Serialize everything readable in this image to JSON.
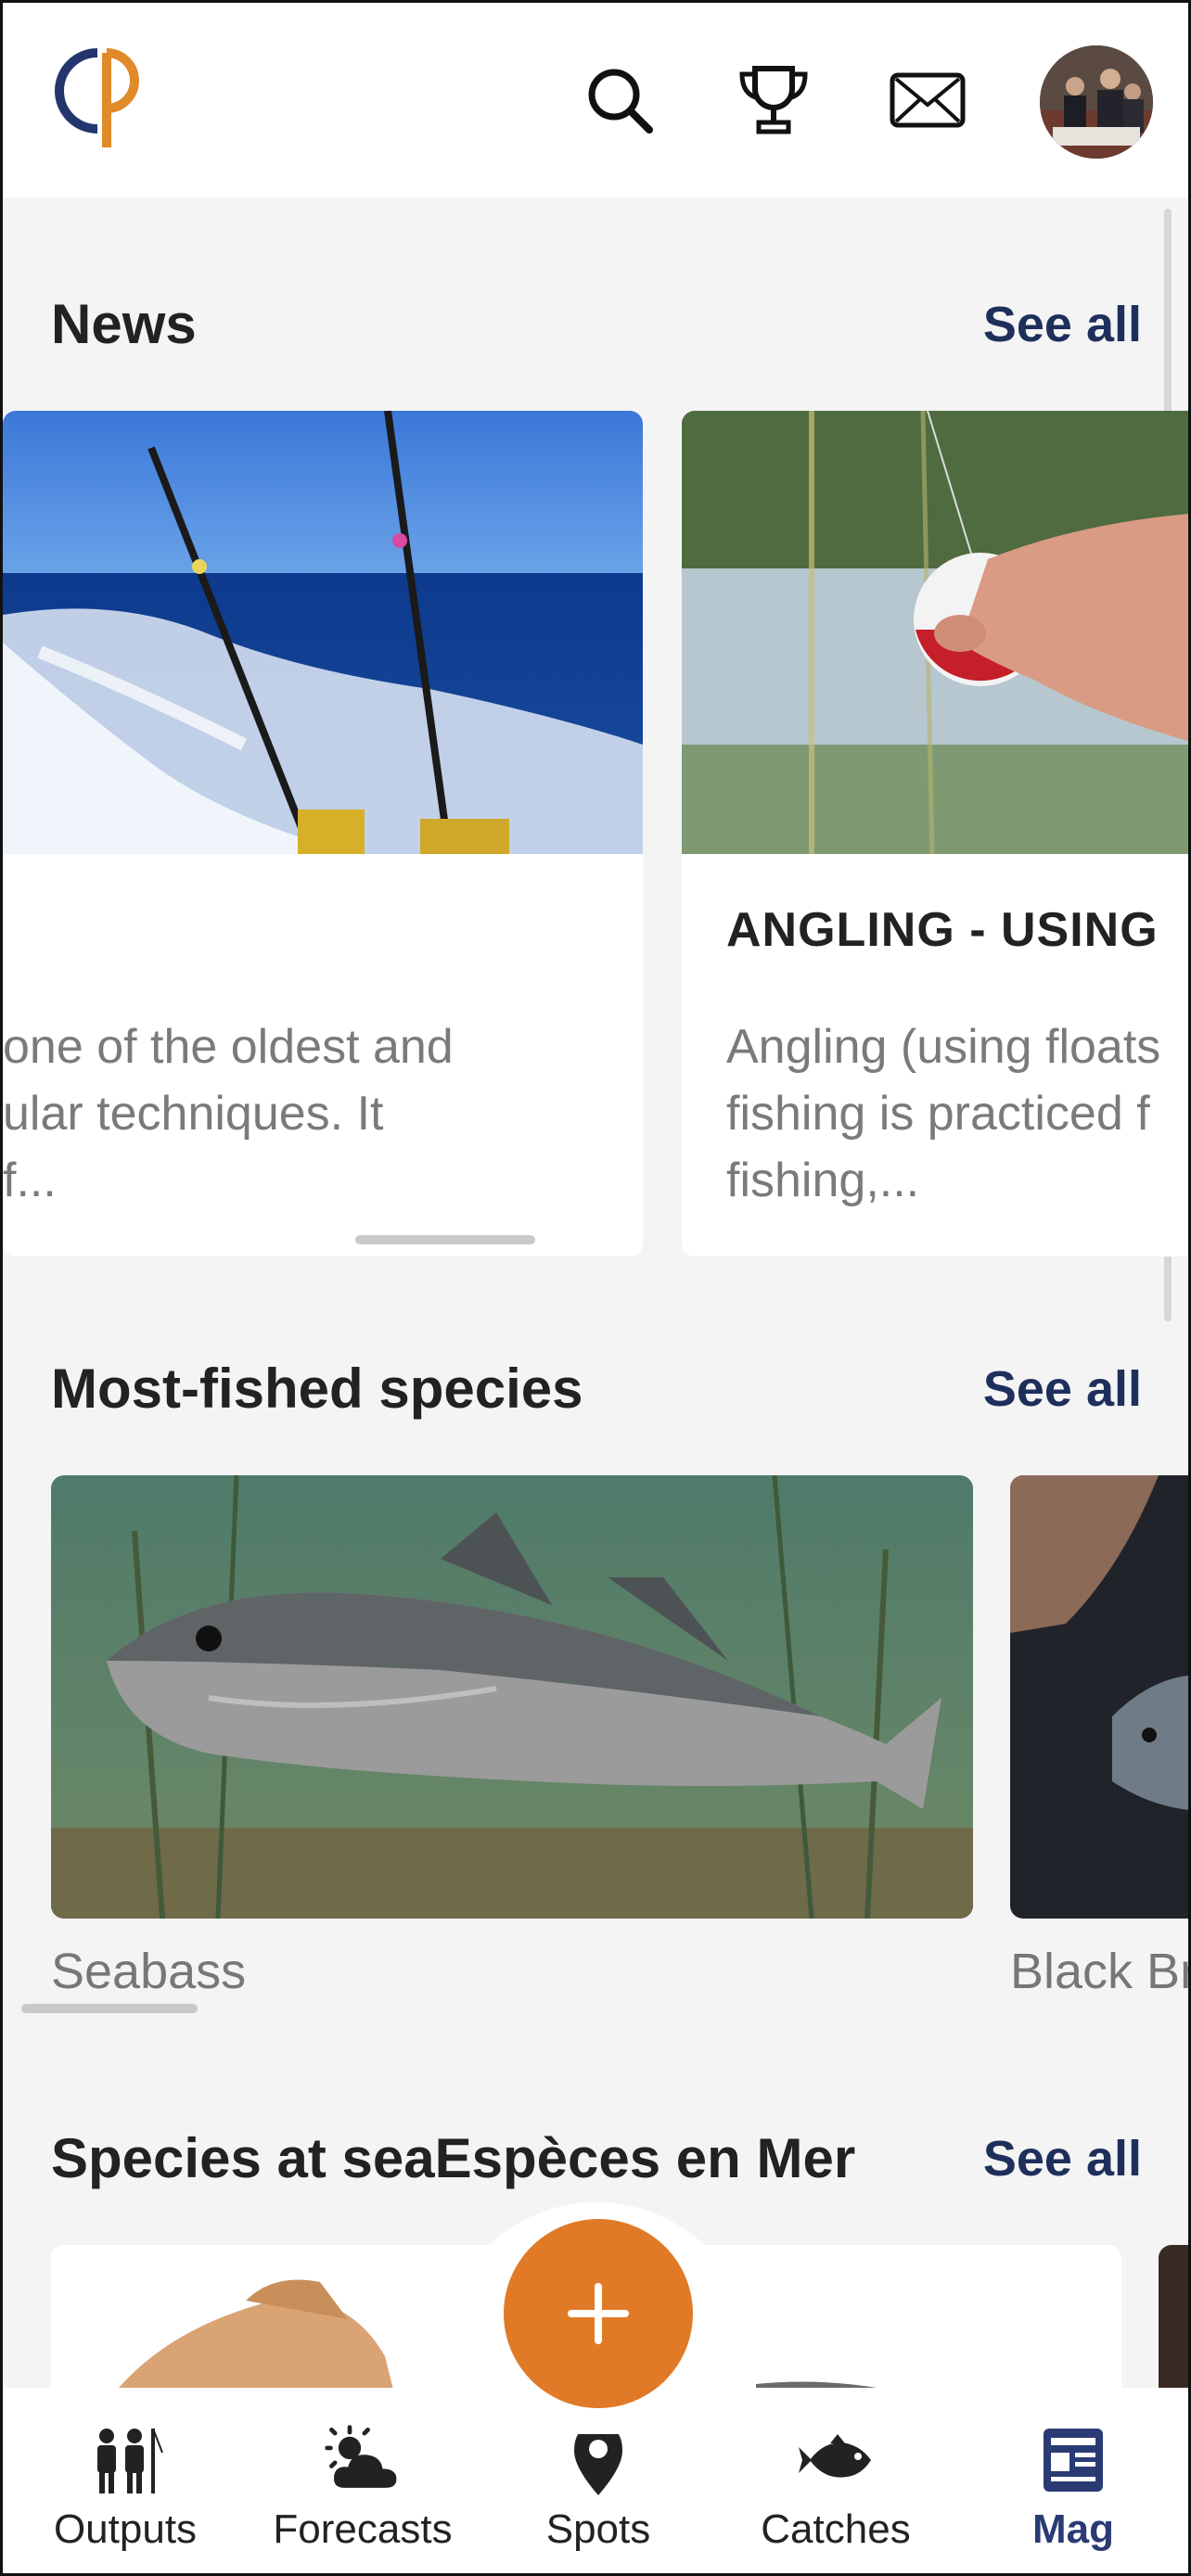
{
  "header": {
    "logo": "cp-logo",
    "icons": [
      "search-icon",
      "trophy-icon",
      "mail-icon"
    ],
    "avatar": "profile-avatar"
  },
  "news": {
    "title": "News",
    "see_all": "See all",
    "cards": [
      {
        "title": "",
        "excerpt": "one of the oldest and\nular techniques. It\nf..."
      },
      {
        "title": "ANGLING - USING",
        "excerpt": "Angling (using floats\nfishing is practiced f\nfishing,..."
      }
    ]
  },
  "species": {
    "title": "Most-fished species",
    "see_all": "See all",
    "items": [
      {
        "name": "Seabass"
      },
      {
        "name": "Black Br"
      }
    ]
  },
  "sea_species": {
    "title": "Species at seaEspèces en Mer",
    "see_all": "See all"
  },
  "tabbar": {
    "fab_icon": "plus-icon",
    "tabs": [
      {
        "label": "Outputs",
        "icon": "people-icon",
        "active": false
      },
      {
        "label": "Forecasts",
        "icon": "weather-icon",
        "active": false
      },
      {
        "label": "Spots",
        "icon": "location-pin-icon",
        "active": false
      },
      {
        "label": "Catches",
        "icon": "fish-icon",
        "active": false
      },
      {
        "label": "Mag",
        "icon": "newspaper-icon",
        "active": true
      }
    ]
  },
  "colors": {
    "accent": "#e07a27",
    "link": "#1f2f5c",
    "active_tab": "#2a3b74"
  }
}
